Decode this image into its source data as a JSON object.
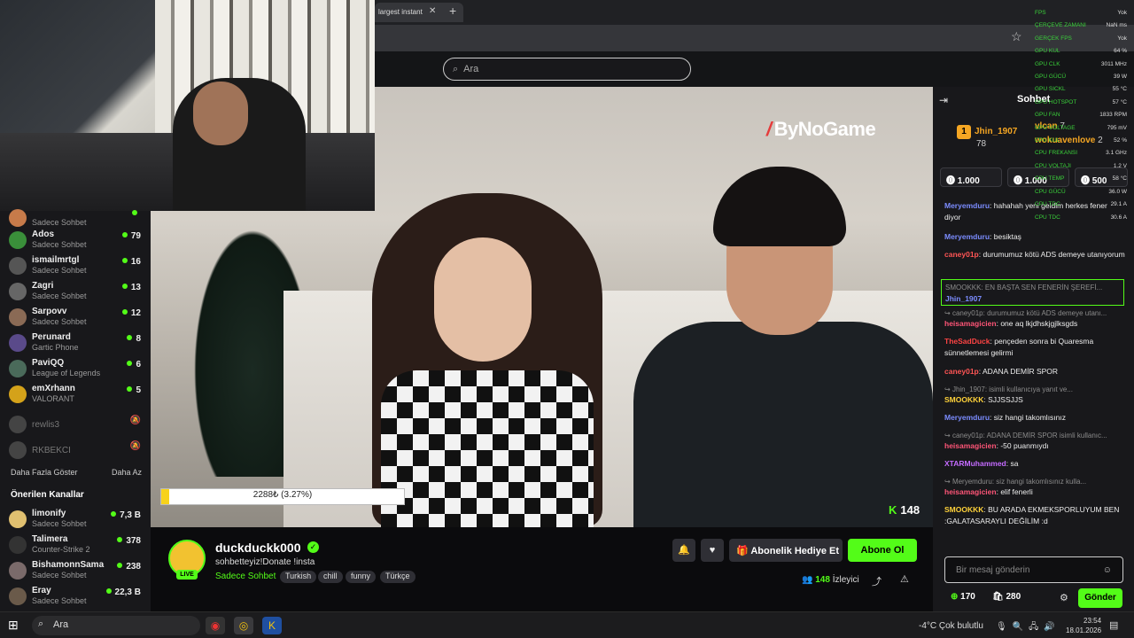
{
  "browser": {
    "tab_title": "largest instant",
    "tab_close": "✕",
    "new_tab": "+",
    "star": "☆"
  },
  "site": {
    "search_placeholder": "Ara"
  },
  "video": {
    "sponsor_logo": "ByNoGame",
    "donate_text": "2288₺ (3.27%)",
    "viewer_badge": "148"
  },
  "sidebar": {
    "channels": [
      {
        "name": "",
        "sub": "Sadece Sohbet",
        "viewers": "",
        "color": "#c77b4a"
      },
      {
        "name": "Ados",
        "sub": "Sadece Sohbet",
        "viewers": "79",
        "color": "#3a8f3a"
      },
      {
        "name": "ismailmrtgl",
        "sub": "Sadece Sohbet",
        "viewers": "16",
        "color": "#555"
      },
      {
        "name": "Zagri",
        "sub": "Sadece Sohbet",
        "viewers": "13",
        "color": "#666"
      },
      {
        "name": "Sarpovv",
        "sub": "Sadece Sohbet",
        "viewers": "12",
        "color": "#8a6a55"
      },
      {
        "name": "Perunard",
        "sub": "Gartic Phone",
        "viewers": "8",
        "color": "#5a4a8a"
      },
      {
        "name": "PaviQQ",
        "sub": "League of Legends",
        "viewers": "6",
        "color": "#4a6a5a"
      },
      {
        "name": "emXrhann",
        "sub": "VALORANT",
        "viewers": "5",
        "color": "#d4a21a"
      },
      {
        "name": "rewlis3",
        "sub": "",
        "viewers": "🔕",
        "color": "#444"
      },
      {
        "name": "RKBEKCI",
        "sub": "",
        "viewers": "🔕",
        "color": "#444"
      }
    ],
    "show_more": "Daha Fazla Göster",
    "show_less": "Daha Az",
    "recommended_title": "Önerilen Kanallar",
    "recommended": [
      {
        "name": "limonify",
        "sub": "Sadece Sohbet",
        "viewers": "7,3 B",
        "color": "#e0c070"
      },
      {
        "name": "Talimera",
        "sub": "Counter-Strike 2",
        "viewers": "378",
        "color": "#333"
      },
      {
        "name": "BishamonnSama",
        "sub": "Sadece Sohbet",
        "viewers": "238",
        "color": "#7a6a6a"
      },
      {
        "name": "Eray",
        "sub": "Sadece Sohbet",
        "viewers": "22,3 B",
        "color": "#6a5a4a"
      }
    ]
  },
  "stream": {
    "name": "duckduckk000",
    "live": "LIVE",
    "title": "sohbetteyiz!Donate !insta",
    "category": "Sadece Sohbet",
    "tags": [
      "Turkish",
      "chill",
      "funny",
      "Türkçe"
    ],
    "gift_label": "Abonelik Hediye Et",
    "subscribe_label": "Abone Ol",
    "viewers_count": "148",
    "viewers_label": "İzleyici"
  },
  "chat": {
    "title": "Sohbet",
    "leaders": [
      {
        "rank": "1",
        "name": "Jhin_1907",
        "value": "78"
      },
      {
        "rank": "",
        "name": "vlcan",
        "value": "7"
      },
      {
        "rank": "",
        "name": "wokuavenlove",
        "value": "2"
      }
    ],
    "gifts": [
      "1.000",
      "1.000",
      "500"
    ],
    "messages": [
      {
        "type": "msg",
        "user": "Meryemduru",
        "color": "#7b8cff",
        "text": "hahahah yeni geldim herkes fener diyor"
      },
      {
        "type": "msg",
        "user": "Meryemduru",
        "color": "#7b8cff",
        "text": "besiktaş"
      },
      {
        "type": "msg",
        "user": "caney01p",
        "color": "#ff5555",
        "text": "durumumuz kötü ADS demeye utanıyorum"
      },
      {
        "type": "pinned",
        "user": "Jhin_1907",
        "color": "#7b8cff",
        "text": "SMOOKKK: EN BAŞTA SEN FENERİN ŞEREFİ..."
      },
      {
        "type": "reply",
        "user": "",
        "color": "#888",
        "text": "caney01p: durumumuz kötü ADS demeye utanı..."
      },
      {
        "type": "msg",
        "user": "heisamagicien",
        "color": "#ff5577",
        "text": "one aq lkjdhskjgjlksgds"
      },
      {
        "type": "msg",
        "user": "TheSadDuck",
        "color": "#ff4444",
        "text": "pençeden sonra bi Quaresma sünnetlemesi gelirmi"
      },
      {
        "type": "msg",
        "user": "caney01p",
        "color": "#ff5555",
        "text": "ADANA DEMİR SPOR"
      },
      {
        "type": "reply",
        "user": "",
        "color": "#888",
        "text": "Jhin_1907: isimli kullanıcıya yanıt ve..."
      },
      {
        "type": "msg",
        "user": "SMOOKKK",
        "color": "#ffd23a",
        "text": "SJJSSJJS"
      },
      {
        "type": "msg",
        "user": "Meryemduru",
        "color": "#7b8cff",
        "text": "siz hangi takomlısınız"
      },
      {
        "type": "reply",
        "user": "",
        "color": "#888",
        "text": "caney01p: ADANA DEMİR SPOR isimli kullanıc..."
      },
      {
        "type": "msg",
        "user": "heisamagicien",
        "color": "#ff5577",
        "text": "-50 puanmıydı"
      },
      {
        "type": "msg",
        "user": "XTARMuhammed",
        "color": "#c46bff",
        "text": "sa"
      },
      {
        "type": "reply",
        "user": "",
        "color": "#888",
        "text": "Meryemduru: siz hangi takomlısınız kulla..."
      },
      {
        "type": "msg",
        "user": "heisamagicien",
        "color": "#ff5577",
        "text": "elif fenerli"
      },
      {
        "type": "msg",
        "user": "SMOOKKK",
        "color": "#ffd23a",
        "text": "BU ARADA EKMEKSPORLUYUM BEN :GALATASARAYLI DEĞİLİM :d"
      }
    ],
    "input_placeholder": "Bir mesaj gönderin",
    "points": "170",
    "gift_count": "280",
    "send_label": "Gönder"
  },
  "hw_overlay": [
    {
      "k": "FPS",
      "v": "Yok"
    },
    {
      "k": "ÇERÇEVE ZAMANI",
      "v": "NaN ms"
    },
    {
      "k": "GERÇEK FPS",
      "v": "Yok"
    },
    {
      "k": "GPU KUL",
      "v": "64 %"
    },
    {
      "k": "GPU CLK",
      "v": "3011 MHz"
    },
    {
      "k": "GPU GÜCÜ",
      "v": "39 W"
    },
    {
      "k": "GPU SICKL",
      "v": "55 °C"
    },
    {
      "k": "GPU HOTSPOT",
      "v": "57 °C"
    },
    {
      "k": "GPU FAN",
      "v": "1833 RPM"
    },
    {
      "k": "GPU VOLTAGE",
      "v": "795 mV"
    },
    {
      "k": "CPU KUL",
      "v": "52 %"
    },
    {
      "k": "CPU FREKANSI",
      "v": "3.1 GHz"
    },
    {
      "k": "CPU VOLTAJI",
      "v": "1.2 V"
    },
    {
      "k": "CPU TEMP",
      "v": "58 °C"
    },
    {
      "k": "CPU GÜCÜ",
      "v": "36.0 W"
    },
    {
      "k": "CPU TDC",
      "v": "29.1 A"
    },
    {
      "k": "CPU TDC",
      "v": "30.6 A"
    }
  ],
  "taskbar": {
    "search": "Ara",
    "weather": "-4°C  Çok bulutlu",
    "time": "23:54",
    "date": "18.01.2026"
  },
  "colors": {
    "accent": "#53fc18",
    "bg": "#0b0b0d",
    "panel": "#18181b"
  }
}
